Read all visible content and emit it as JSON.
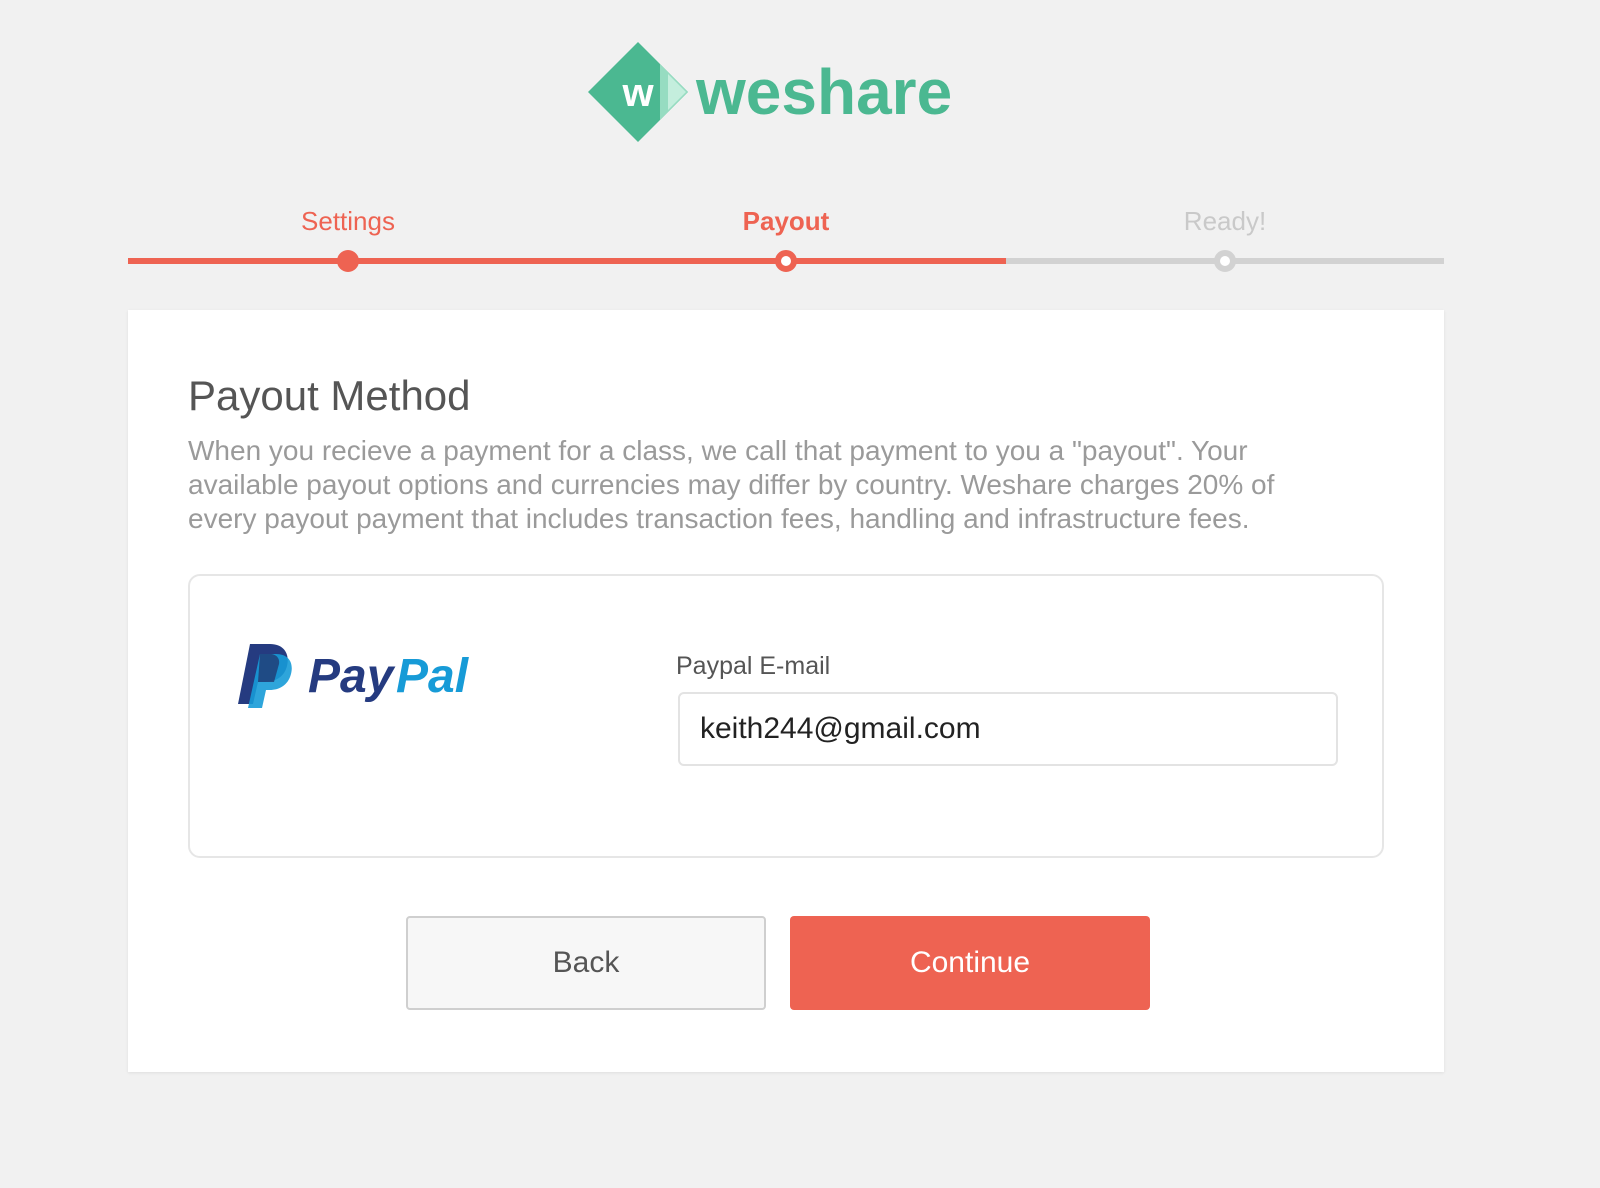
{
  "brand": {
    "name": "weshare",
    "mark_letter": "w",
    "color": "#4bb891"
  },
  "accent_color": "#ee6352",
  "stepper": {
    "steps": [
      {
        "label": "Settings",
        "state": "done"
      },
      {
        "label": "Payout",
        "state": "current"
      },
      {
        "label": "Ready!",
        "state": "future"
      }
    ]
  },
  "card": {
    "title": "Payout Method",
    "description": "When you recieve a payment for a class, we call that payment to you a \"payout\". Your available payout options and currencies may differ by country. Weshare charges 20% of every payout payment that includes transaction fees, handling and infrastructure fees.",
    "payout_method": {
      "provider": "PayPal",
      "provider_part1": "Pay",
      "provider_part2": "Pal",
      "field_label": "Paypal E-mail",
      "email_value": "keith244@gmail.com"
    },
    "buttons": {
      "back_label": "Back",
      "continue_label": "Continue"
    }
  }
}
